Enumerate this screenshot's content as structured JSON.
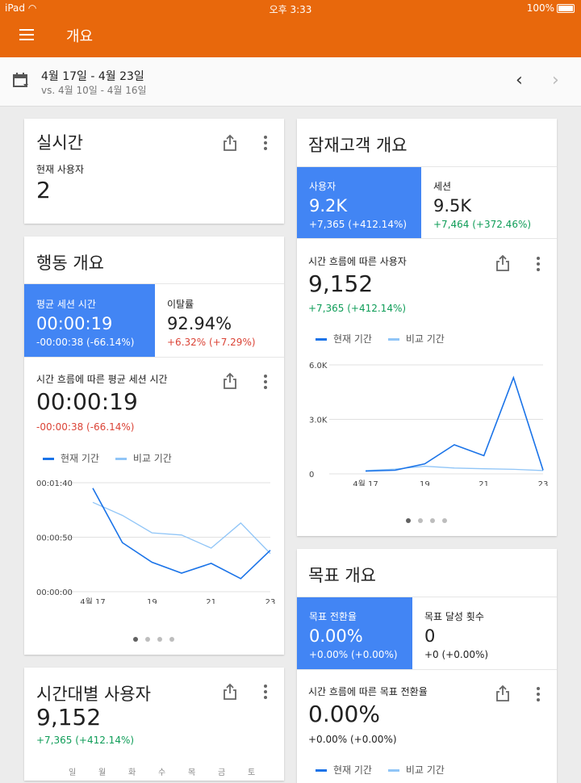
{
  "status": {
    "device": "iPad",
    "time": "오후 3:33",
    "battery": "100%"
  },
  "appbar": {
    "title": "개요"
  },
  "daterange": {
    "current": "4월 17일 - 4월 23일",
    "compare": "vs. 4월 10일 - 4월 16일"
  },
  "colors": {
    "accent": "#e8680c",
    "selected": "#4285f4",
    "positive": "#0f9d58",
    "negative": "#db4437",
    "series_current": "#1a73e8",
    "series_compare": "#90c5f7"
  },
  "realtime": {
    "title": "실시간",
    "label": "현재 사용자",
    "value": "2"
  },
  "behavior": {
    "title": "행동 개요",
    "tiles": [
      {
        "label": "평균 세션 시간",
        "value": "00:00:19",
        "delta": "-00:00:38 (-66.14%)"
      },
      {
        "label": "이탈률",
        "value": "92.94%",
        "delta": "+6.32% (+7.29%)"
      }
    ],
    "metric_title": "시간 흐름에 따른 평균 세션 시간",
    "metric_value": "00:00:19",
    "metric_delta": "-00:00:38 (-66.14%)",
    "legend_current": "현재 기간",
    "legend_compare": "비교 기간"
  },
  "audience": {
    "title": "잠재고객 개요",
    "tiles": [
      {
        "label": "사용자",
        "value": "9.2K",
        "delta": "+7,365 (+412.14%)"
      },
      {
        "label": "세션",
        "value": "9.5K",
        "delta": "+7,464 (+372.46%)"
      }
    ],
    "metric_title": "시간 흐름에 따른 사용자",
    "metric_value": "9,152",
    "metric_delta": "+7,365 (+412.14%)",
    "legend_current": "현재 기간",
    "legend_compare": "비교 기간"
  },
  "hourly": {
    "title": "시간대별 사용자",
    "value": "9,152",
    "delta": "+7,365 (+412.14%)",
    "days": [
      "일",
      "월",
      "화",
      "수",
      "목",
      "금",
      "토"
    ]
  },
  "goals": {
    "title": "목표 개요",
    "tiles": [
      {
        "label": "목표 전환율",
        "value": "0.00%",
        "delta": "+0.00% (+0.00%)"
      },
      {
        "label": "목표 달성 횟수",
        "value": "0",
        "delta": "+0 (+0.00%)"
      }
    ],
    "metric_title": "시간 흐름에 따른 목표 전환율",
    "metric_value": "0.00%",
    "metric_delta": "+0.00% (+0.00%)",
    "legend_current": "현재 기간",
    "legend_compare": "비교 기간"
  },
  "chart_data": [
    {
      "type": "line",
      "x": [
        "4월 17",
        "18",
        "19",
        "20",
        "21",
        "22",
        "23"
      ],
      "x_tick_labels": [
        "4월 17",
        "19",
        "21",
        "23"
      ],
      "y_tick_labels": [
        "00:01:40",
        "00:00:50",
        "00:00:00"
      ],
      "ylim_seconds": [
        0,
        100
      ],
      "series": [
        {
          "name": "현재 기간",
          "values": [
            95,
            45,
            27,
            17,
            26,
            12,
            38
          ]
        },
        {
          "name": "비교 기간",
          "values": [
            82,
            70,
            54,
            52,
            40,
            63,
            35
          ]
        }
      ]
    },
    {
      "type": "line",
      "x": [
        "4월 17",
        "18",
        "19",
        "20",
        "21",
        "22",
        "23"
      ],
      "x_tick_labels": [
        "4월 17",
        "19",
        "21",
        "23"
      ],
      "y_tick_labels": [
        "6.0K",
        "3.0K",
        "0"
      ],
      "ylim": [
        0,
        6000
      ],
      "series": [
        {
          "name": "현재 기간",
          "values": [
            150,
            200,
            550,
            1600,
            1000,
            5300,
            200
          ]
        },
        {
          "name": "비교 기간",
          "values": [
            180,
            260,
            420,
            320,
            280,
            250,
            180
          ]
        }
      ]
    }
  ]
}
